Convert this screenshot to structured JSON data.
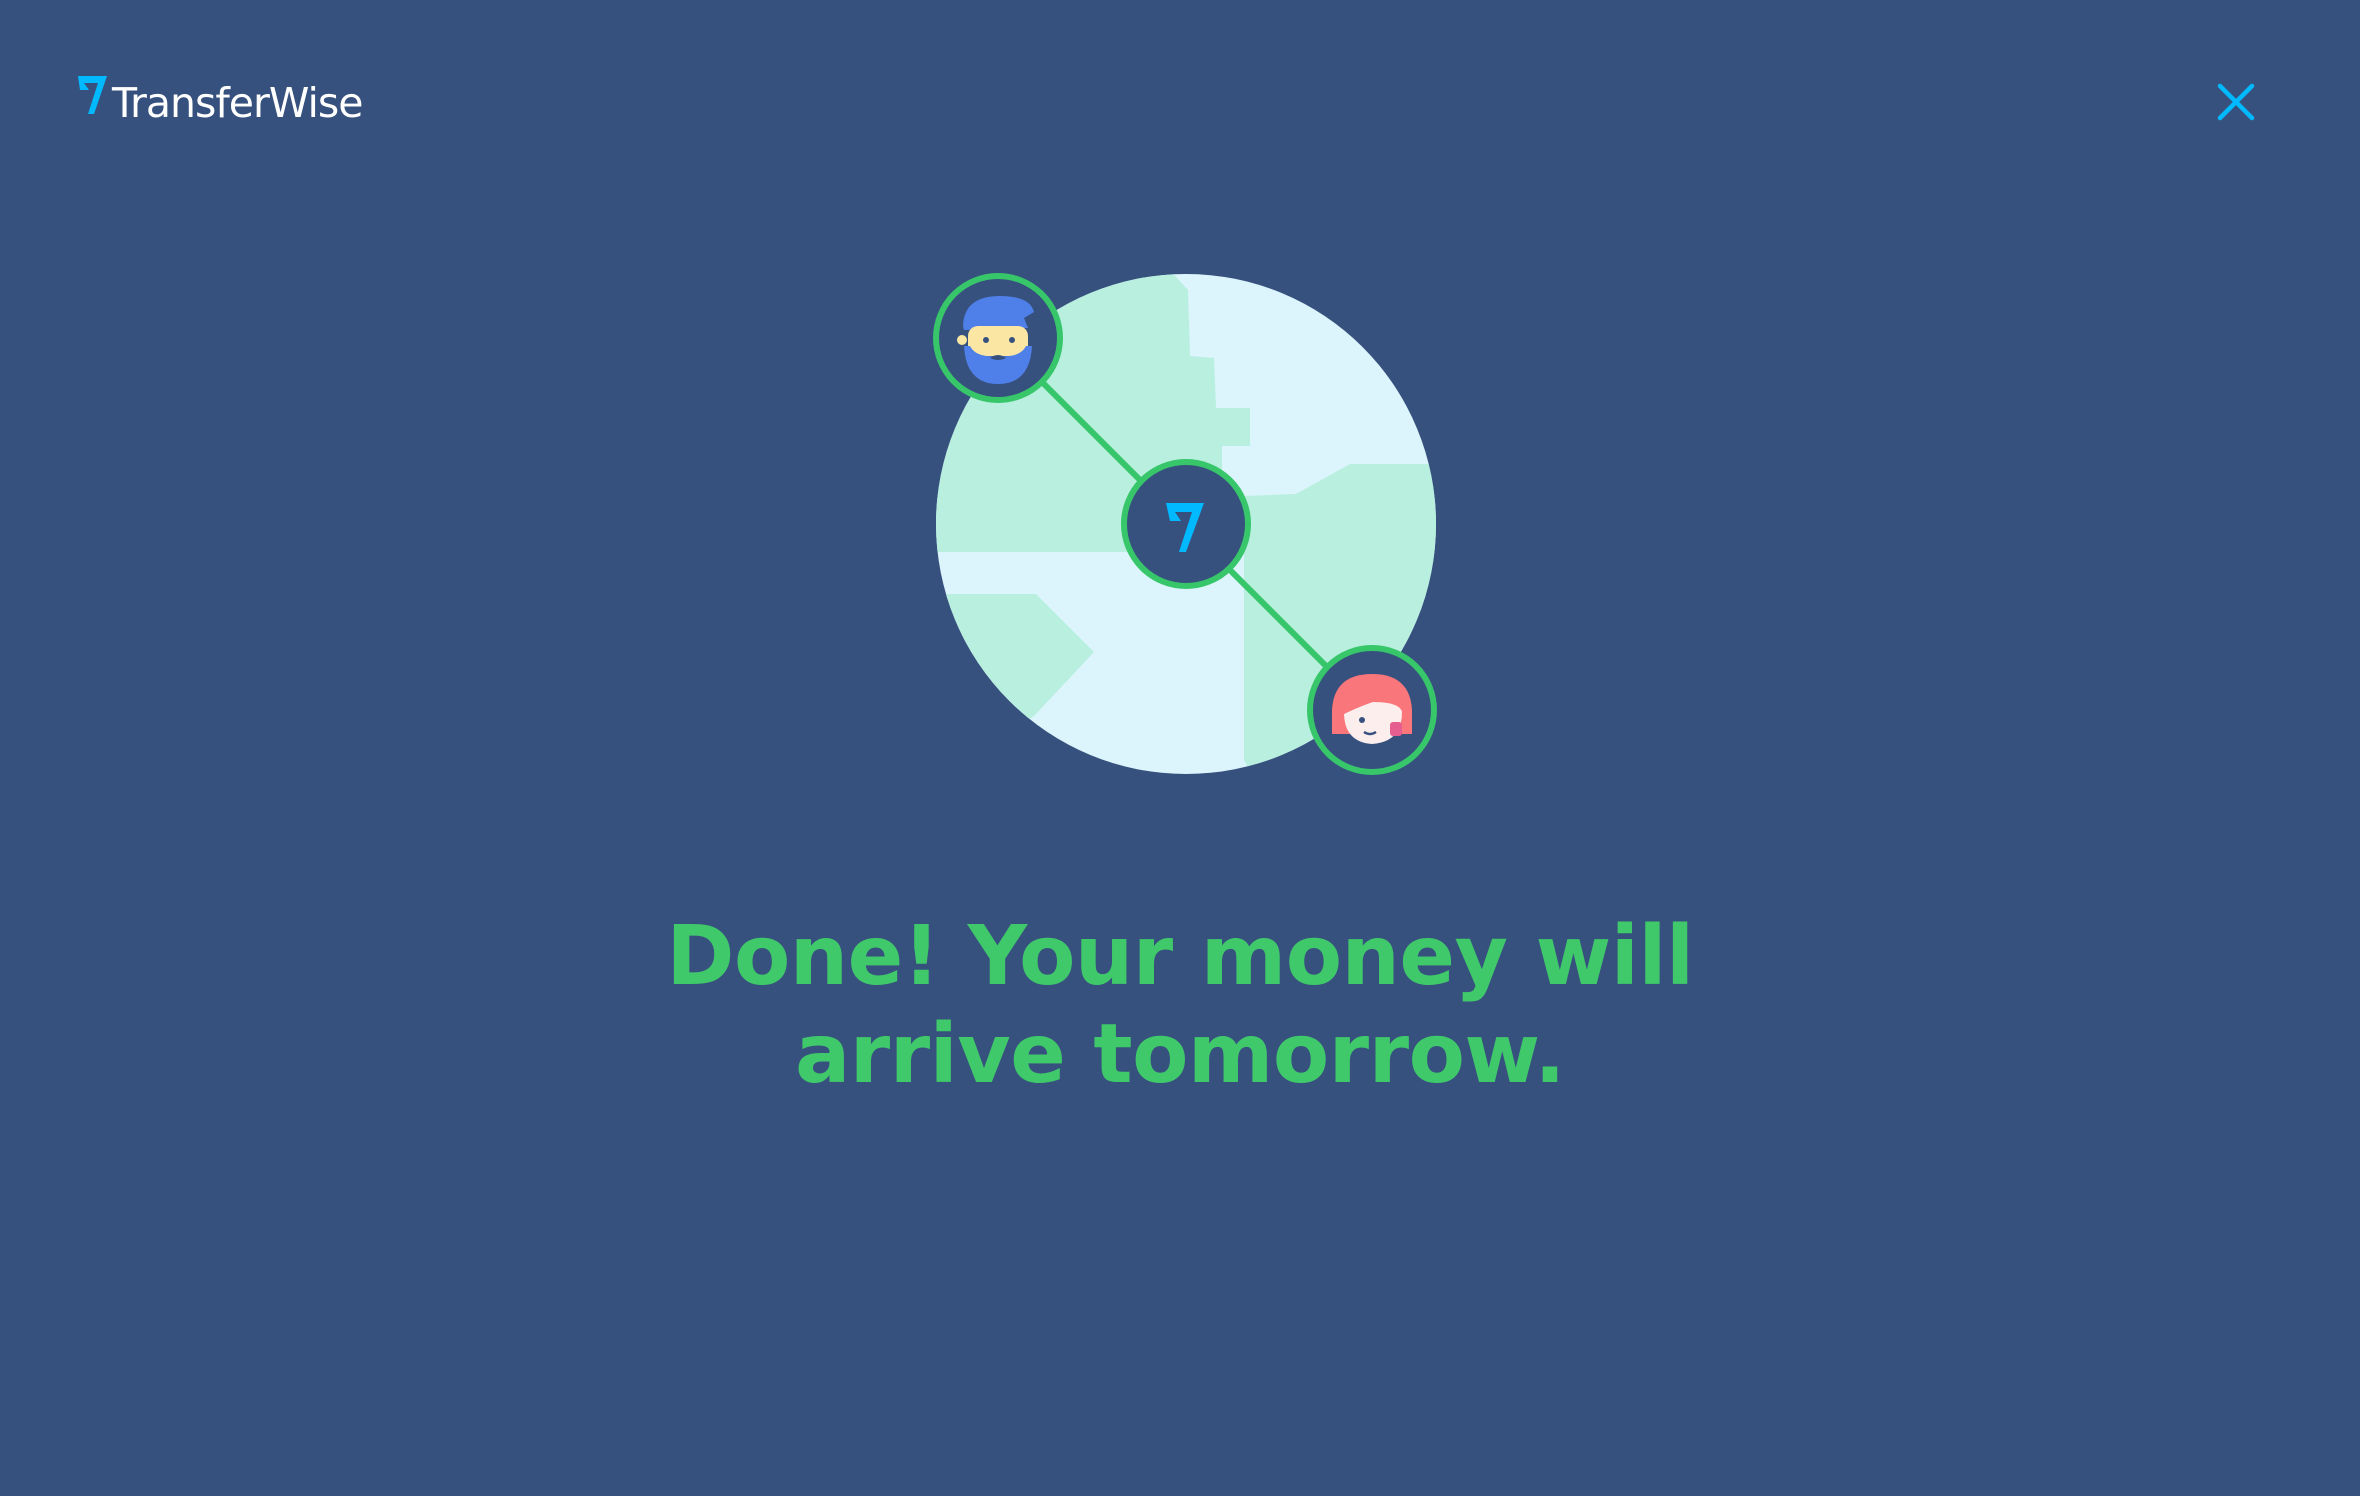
{
  "brand": {
    "name": "TransferWise",
    "logo_icon": "transferwise-flag-icon"
  },
  "header": {
    "close_icon": "close-icon"
  },
  "illustration": {
    "sender_avatar_icon": "bearded-man-avatar-icon",
    "hub_icon": "transferwise-flag-icon",
    "recipient_avatar_icon": "red-haired-woman-avatar-icon",
    "globe_icon": "globe-icon"
  },
  "message": {
    "line1": "Done! Your money will",
    "line2": "arrive tomorrow."
  },
  "colors": {
    "background": "#37517e",
    "accent_green": "#3fc96a",
    "accent_blue": "#00b9ff",
    "globe_water": "#dcf4fc",
    "globe_land": "#b8efdf",
    "text_white": "#ffffff"
  }
}
